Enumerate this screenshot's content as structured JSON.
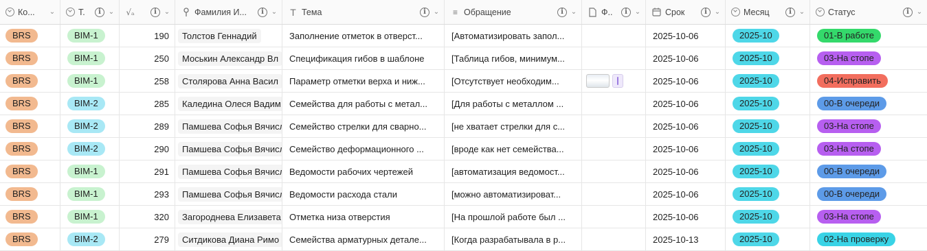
{
  "columns": [
    {
      "label": "Ко...",
      "icon": "single-select-icon"
    },
    {
      "label": "Т.",
      "icon": "single-select-icon"
    },
    {
      "label": "",
      "icon": "formula-icon"
    },
    {
      "label": "Фамилия И...",
      "icon": "pin-icon"
    },
    {
      "label": "Тема",
      "icon": "text-icon"
    },
    {
      "label": "Обращение",
      "icon": "long-text-icon"
    },
    {
      "label": "Ф..",
      "icon": "file-icon"
    },
    {
      "label": "Срок",
      "icon": "calendar-icon"
    },
    {
      "label": "Месяц",
      "icon": "single-select-icon"
    },
    {
      "label": "Статус",
      "icon": "single-select-icon"
    }
  ],
  "colors": {
    "brs": "#f2b98f",
    "bim1": "#c8f2cf",
    "bim2": "#a8e8f5",
    "month": "#4ed7e8",
    "status_in_work": "#34d96b",
    "status_stopped": "#b75ff0",
    "status_fix": "#f26e5e",
    "status_queue": "#5d9be8",
    "status_review": "#39d3e6"
  },
  "rows": [
    {
      "company": "BRS",
      "type": "BIM-1",
      "num": "190",
      "name": "Толстов Геннадий",
      "topic": "Заполнение отметок в отверст...",
      "request": "[Автоматизировать запол...",
      "date": "2025-10-06",
      "month": "2025-10",
      "status": "01-В работе"
    },
    {
      "company": "BRS",
      "type": "BIM-1",
      "num": "250",
      "name": "Моськин Александр Вл",
      "topic": "Спецификация гибов в шаблоне",
      "request": "[Таблица гибов, минимум...",
      "date": "2025-10-06",
      "month": "2025-10",
      "status": "03-На стопе"
    },
    {
      "company": "BRS",
      "type": "BIM-1",
      "num": "258",
      "name": "Столярова Анна Васил",
      "topic": "Параметр отметки верха и ниж...",
      "request": "[Отсутствует необходим...",
      "date": "2025-10-06",
      "month": "2025-10",
      "status": "04-Исправить"
    },
    {
      "company": "BRS",
      "type": "BIM-2",
      "num": "285",
      "name": "Каледина Олеся Вадим",
      "topic": "Семейства для работы с метал...",
      "request": "[Для работы с металлом ...",
      "date": "2025-10-06",
      "month": "2025-10",
      "status": "00-В очереди"
    },
    {
      "company": "BRS",
      "type": "BIM-2",
      "num": "289",
      "name": "Памшева Софья Вячисл",
      "topic": "Семейство стрелки для сварно...",
      "request": "[не хватает стрелки для с...",
      "date": "2025-10-06",
      "month": "2025-10",
      "status": "03-На стопе"
    },
    {
      "company": "BRS",
      "type": "BIM-2",
      "num": "290",
      "name": "Памшева Софья Вячисл",
      "topic": "Семейство деформационного ...",
      "request": "[вроде как нет семейства...",
      "date": "2025-10-06",
      "month": "2025-10",
      "status": "03-На стопе"
    },
    {
      "company": "BRS",
      "type": "BIM-1",
      "num": "291",
      "name": "Памшева Софья Вячисл",
      "topic": "Ведомости рабочих чертежей",
      "request": "[автоматизация ведомост...",
      "date": "2025-10-06",
      "month": "2025-10",
      "status": "00-В очереди"
    },
    {
      "company": "BRS",
      "type": "BIM-1",
      "num": "293",
      "name": "Памшева Софья Вячисл",
      "topic": "Ведомости расхода стали",
      "request": "[можно автоматизироват...",
      "date": "2025-10-06",
      "month": "2025-10",
      "status": "00-В очереди"
    },
    {
      "company": "BRS",
      "type": "BIM-1",
      "num": "320",
      "name": "Загороднева Елизавета",
      "topic": "Отметка низа отверстия",
      "request": "[На прошлой работе был ...",
      "date": "2025-10-06",
      "month": "2025-10",
      "status": "03-На стопе"
    },
    {
      "company": "BRS",
      "type": "BIM-2",
      "num": "279",
      "name": "Ситдикова Диана Римо",
      "topic": "Семейства арматурных детале...",
      "request": "[Когда разрабатывала в р...",
      "date": "2025-10-13",
      "month": "2025-10",
      "status": "02-На проверку"
    }
  ]
}
